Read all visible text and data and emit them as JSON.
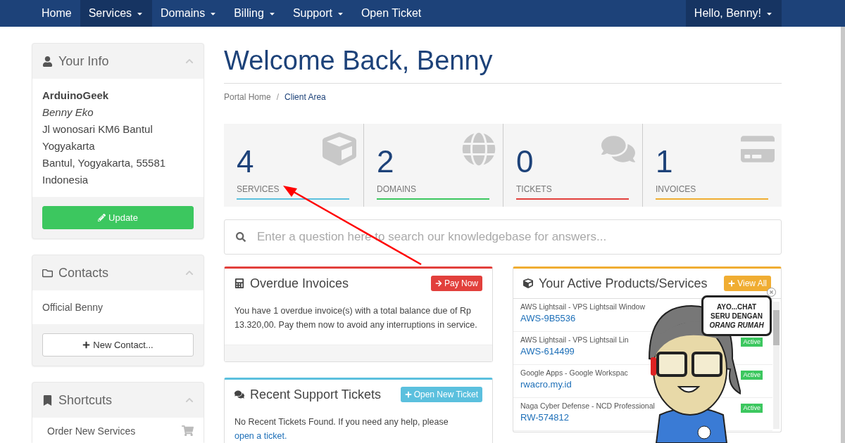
{
  "nav": {
    "items": [
      {
        "label": "Home",
        "dropdown": false,
        "selected": false
      },
      {
        "label": "Services",
        "dropdown": true,
        "selected": true
      },
      {
        "label": "Domains",
        "dropdown": true,
        "selected": false
      },
      {
        "label": "Billing",
        "dropdown": true,
        "selected": false
      },
      {
        "label": "Support",
        "dropdown": true,
        "selected": false
      },
      {
        "label": "Open Ticket",
        "dropdown": false,
        "selected": false
      }
    ],
    "user": {
      "label": "Hello, Benny!",
      "dropdown": true
    }
  },
  "sidebar": {
    "panels": [
      {
        "kind": "info",
        "title": "Your Info",
        "company": "ArduinoGeek",
        "name": "Benny Eko",
        "address_lines": [
          "Jl wonosari KM6 Bantul",
          "Yogyakarta",
          "Bantul, Yogyakarta, 55581",
          "Indonesia"
        ],
        "button": "Update"
      },
      {
        "kind": "contacts",
        "title": "Contacts",
        "items": [
          "Official Benny"
        ],
        "button": "New Contact..."
      },
      {
        "kind": "shortcuts",
        "title": "Shortcuts",
        "items": [
          "Order New Services"
        ]
      }
    ]
  },
  "main": {
    "title": "Welcome Back, Benny",
    "breadcrumb_separator": "/",
    "breadcrumb": [
      {
        "label": "Portal Home",
        "selected": false
      },
      {
        "label": "Client Area",
        "selected": true
      }
    ],
    "tiles": [
      {
        "kind": "services",
        "count": "4",
        "label": "SERVICES",
        "color": "#5bc0de"
      },
      {
        "kind": "domains",
        "count": "2",
        "label": "DOMAINS",
        "color": "#3cc75f"
      },
      {
        "kind": "tickets",
        "count": "0",
        "label": "TICKETS",
        "color": "#e2403c"
      },
      {
        "kind": "invoices",
        "count": "1",
        "label": "INVOICES",
        "color": "#f0ad32"
      }
    ],
    "search": {
      "placeholder": "Enter a question here to search our knowledgebase for answers..."
    },
    "left_panels": [
      {
        "kind": "invoices",
        "title": "Overdue Invoices",
        "color": "#e2403c",
        "button": "Pay Now",
        "text": "You have 1 overdue invoice(s) with a total balance due of Rp 13.320,00. Pay them now to avoid any interruptions in service."
      },
      {
        "kind": "tickets",
        "title": "Recent Support Tickets",
        "color": "#5bc0de",
        "button": "Open New Ticket",
        "text": "No Recent Tickets Found. If you need any help, please",
        "link": "open a ticket."
      }
    ],
    "products": {
      "title": "Your Active Products/Services",
      "color": "#f0ad32",
      "button": "View All",
      "rows": [
        {
          "name": "AWS Lightsail - VPS Lightsail Window",
          "id": "AWS-9B5536"
        },
        {
          "name": "AWS Lightsail - VPS Lightsail Lin",
          "id": "AWS-614499",
          "status": "Active"
        },
        {
          "name": "Google Apps - Google Workspac",
          "id": "rwacro.my.id",
          "status": "Active"
        },
        {
          "name": "Naga Cyber Defense - NCD Professional",
          "id": "RW-574812",
          "status": "Active"
        }
      ]
    }
  },
  "chat_widget": {
    "bubble": [
      "AYO...CHAT",
      "SERU DENGAN",
      "ORANG RUMAH"
    ]
  }
}
